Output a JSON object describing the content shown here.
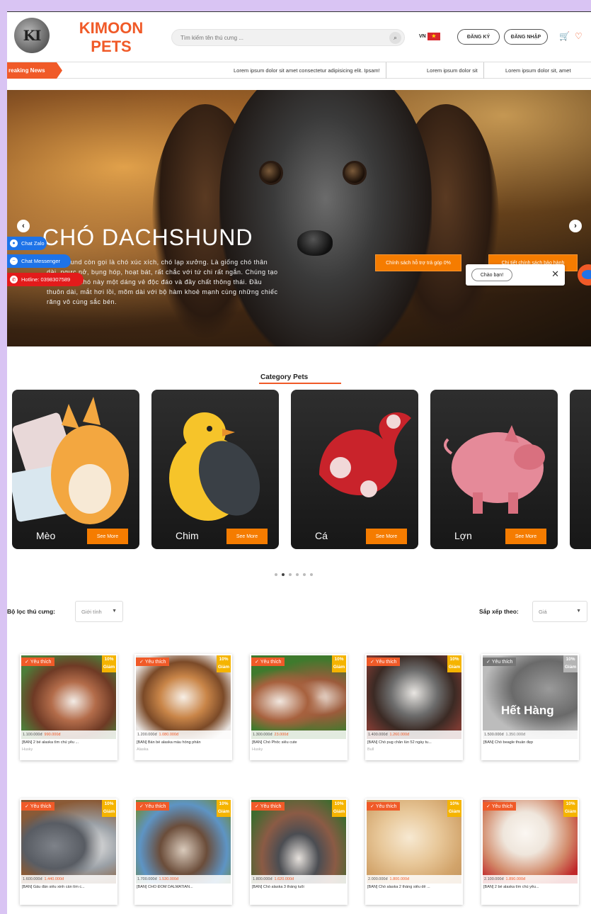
{
  "header": {
    "logo_text": "KI",
    "brand_line1": "KIMOON",
    "brand_line2": "PETS",
    "search_placeholder": "Tìm kiếm tên thú cưng ...",
    "lang": "VN",
    "register_label": "ĐĂNG KÝ",
    "login_label": "ĐĂNG NHẬP"
  },
  "breaking": {
    "label": "reaking News",
    "items": [
      "Lorem ipsum dolor sit amet consectetur adipisicing elit. Ipsam!",
      "Lorem ipsum dolor sit",
      "Lorem ipsum dolor sit, amet"
    ]
  },
  "hero": {
    "title": "CHÓ DACHSHUND",
    "text": "Dachshund còn gọi là chó xúc xích, chó lạp xưởng. Là giống chó thân dài, ngực nở, bụng hóp, hoạt bát, rất chắc với tứ chi rất ngắn. Chúng tạo cho giống chó này một dáng vẻ độc đáo và đầy chất thông thái. Đầu thuôn dài, mắt hơi lồi, mõm dài với bộ hàm khoẻ mạnh cùng những chiếc răng vô cùng sắc bén.",
    "btn_installment": "Chính sách hỗ trợ trả góp 0%",
    "btn_warranty": "Chi tiết chính sách bảo hành",
    "prev_icon": "‹",
    "next_icon": "›"
  },
  "chat": {
    "zalo": "Chat Zalo",
    "messenger": "Chat Messenger",
    "hotline": "Hotline: 0398307589",
    "greeting": "Chào bạn!",
    "close": "✕"
  },
  "category": {
    "title": "Category Pets",
    "see_more": "See More",
    "items": [
      "Mèo",
      "Chim",
      "Cá",
      "Lợn"
    ]
  },
  "filters": {
    "filter_label": "Bộ lọc thú cưng:",
    "filter_value": "Giới tính",
    "sort_label": "Sắp xếp theo:",
    "sort_value": "Giá"
  },
  "product_common": {
    "fav_label": "Yêu thích",
    "sale_top": "10%",
    "sale_bottom": "Giảm",
    "sold_out": "Hết Hàng"
  },
  "products": [
    {
      "old": "1.100.000đ",
      "new": "990.000đ",
      "name": "[BÁN] 2 bé alaska tìm chủ yêu ...",
      "breed": "Husky"
    },
    {
      "old": "1.200.000đ",
      "new": "1.080.000đ",
      "name": "[BÁN] Bán bé alaska màu hồng phấn",
      "breed": "Alaska"
    },
    {
      "old": "1.300.000đ",
      "new": "23.000đ",
      "name": "[BÁN] Chó Phốc siêu cute",
      "breed": "Husky"
    },
    {
      "old": "1.400.000đ",
      "new": "1.260.000đ",
      "name": "[BÁN] Chó pug chân lùn 52 ngày tu...",
      "breed": "Bull"
    },
    {
      "old": "1.500.000đ",
      "new": "1.350.000đ",
      "name": "[BÁN] Chó beagle thuần đẹp",
      "breed": ""
    },
    {
      "old": "1.600.000đ",
      "new": "1.440.000đ",
      "name": "[BÁN] Gấu đần siêu xinh cần tìm c...",
      "breed": ""
    },
    {
      "old": "1.700.000đ",
      "new": "1.530.000đ",
      "name": "[BÁN] CHÓ ĐỐM DALMATIAN...",
      "breed": ""
    },
    {
      "old": "1.800.000đ",
      "new": "1.620.000đ",
      "name": "[BÁN] Chó alaska 3 tháng tuổi",
      "breed": ""
    },
    {
      "old": "2.000.000đ",
      "new": "1.800.000đ",
      "name": "[BÁN] Chó alaska 2 tháng siêu dễ ...",
      "breed": ""
    },
    {
      "old": "2.100.000đ",
      "new": "1.890.000đ",
      "name": "[BÁN] 2 bé alaska tìm chủ yêu...",
      "breed": ""
    }
  ]
}
